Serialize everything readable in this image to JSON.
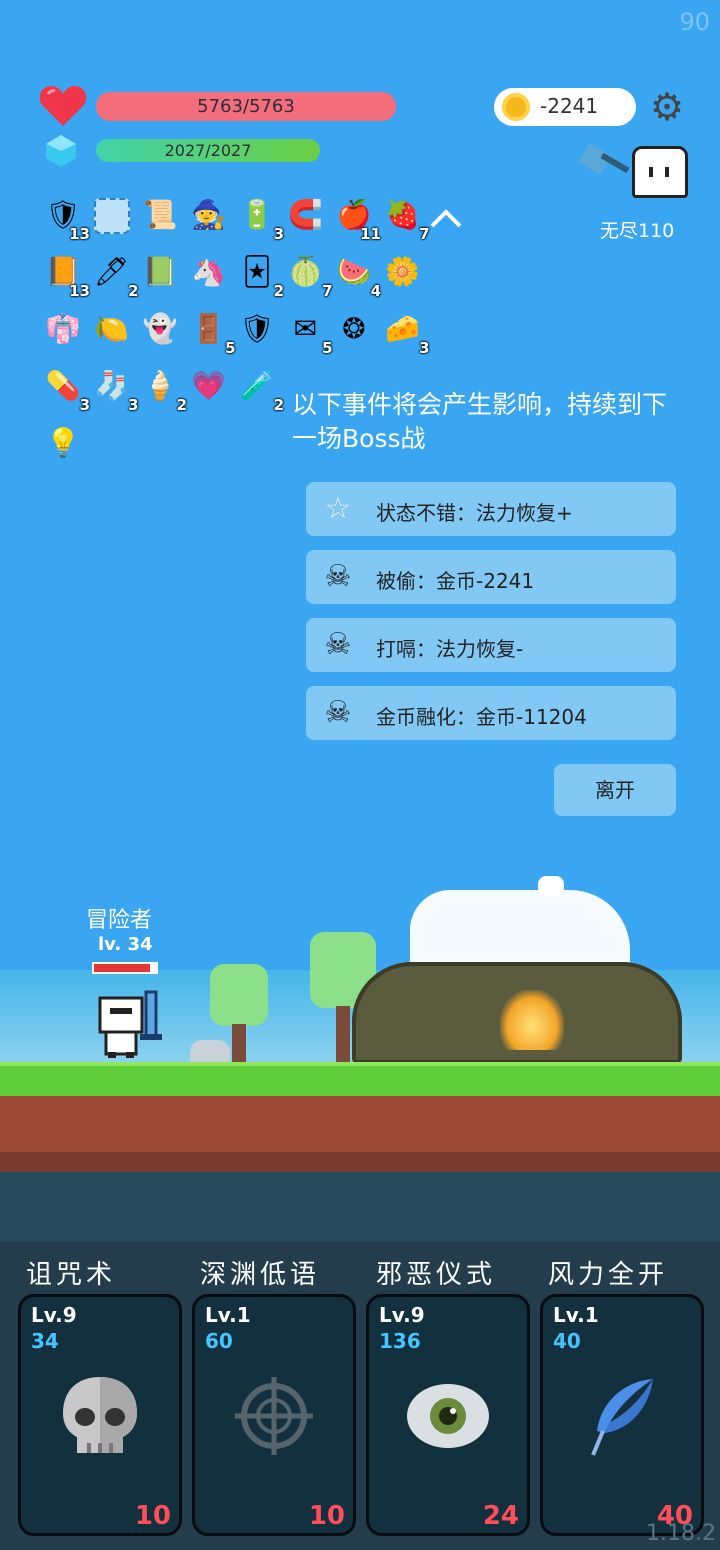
{
  "fps": "90",
  "version": "1.18.2",
  "stats": {
    "hp_text": "5763/5763",
    "mp_text": "2027/2027",
    "coins": "-2241"
  },
  "mode_label": "无尽110",
  "inventory": [
    {
      "icon": "shield-icon",
      "count": "13"
    },
    {
      "icon": "empty-slot-icon",
      "count": ""
    },
    {
      "icon": "scroll-icon",
      "count": ""
    },
    {
      "icon": "wizard-hat-icon",
      "count": ""
    },
    {
      "icon": "battery-icon",
      "count": "3"
    },
    {
      "icon": "magnet-icon",
      "count": ""
    },
    {
      "icon": "apple-icon",
      "count": "11"
    },
    {
      "icon": "strawberry-icon",
      "count": "7"
    },
    {
      "icon": "book-icon",
      "count": "13"
    },
    {
      "icon": "pen-icon",
      "count": "2"
    },
    {
      "icon": "green-card-icon",
      "count": ""
    },
    {
      "icon": "unicorn-icon",
      "count": ""
    },
    {
      "icon": "playing-cards-icon",
      "count": "2"
    },
    {
      "icon": "durian-icon",
      "count": "7"
    },
    {
      "icon": "watermelon-icon",
      "count": "4"
    },
    {
      "icon": "flower-icon",
      "count": ""
    },
    {
      "icon": "robe-icon",
      "count": ""
    },
    {
      "icon": "lime-icon",
      "count": ""
    },
    {
      "icon": "ghost-icon",
      "count": ""
    },
    {
      "icon": "door-icon",
      "count": "5"
    },
    {
      "icon": "crest-shield-icon",
      "count": ""
    },
    {
      "icon": "envelope-icon",
      "count": "5"
    },
    {
      "icon": "molecule-icon",
      "count": ""
    },
    {
      "icon": "cheese-icon",
      "count": "3"
    },
    {
      "icon": "pill-icon",
      "count": "3"
    },
    {
      "icon": "sock-icon",
      "count": "3"
    },
    {
      "icon": "ice-cream-icon",
      "count": "2"
    },
    {
      "icon": "heart-drop-icon",
      "count": ""
    },
    {
      "icon": "potion-icon",
      "count": "2"
    },
    {
      "icon": "lightbulb-icon",
      "count": ""
    }
  ],
  "notice": "以下事件将会产生影响，持续到下一场Boss战",
  "events": [
    {
      "icon": "star-icon",
      "text": "状态不错：法力恢复+"
    },
    {
      "icon": "skull-crossbones-icon",
      "text": "被偷：金币-2241"
    },
    {
      "icon": "skull-crossbones-icon",
      "text": "打嗝：法力恢复-"
    },
    {
      "icon": "skull-crossbones-icon",
      "text": "金币融化：金币-11204"
    }
  ],
  "leave_label": "离开",
  "hero": {
    "name": "冒险者",
    "level": "lv. 34",
    "hp_fraction": 0.9
  },
  "skills": [
    {
      "name": "诅咒术",
      "level": "Lv.9",
      "power": "34",
      "cost": "10",
      "icon": "skull-icon"
    },
    {
      "name": "深渊低语",
      "level": "Lv.1",
      "power": "60",
      "cost": "10",
      "icon": "crosshair-icon"
    },
    {
      "name": "邪恶仪式",
      "level": "Lv.9",
      "power": "136",
      "cost": "24",
      "icon": "eye-icon"
    },
    {
      "name": "风力全开",
      "level": "Lv.1",
      "power": "40",
      "cost": "40",
      "icon": "feather-icon"
    }
  ],
  "colors": {
    "sky": "#3aa6f2",
    "hp": "#f36d7b",
    "card_bg": "#12303e",
    "cost": "#ff4d5a",
    "power": "#47c4ff"
  }
}
